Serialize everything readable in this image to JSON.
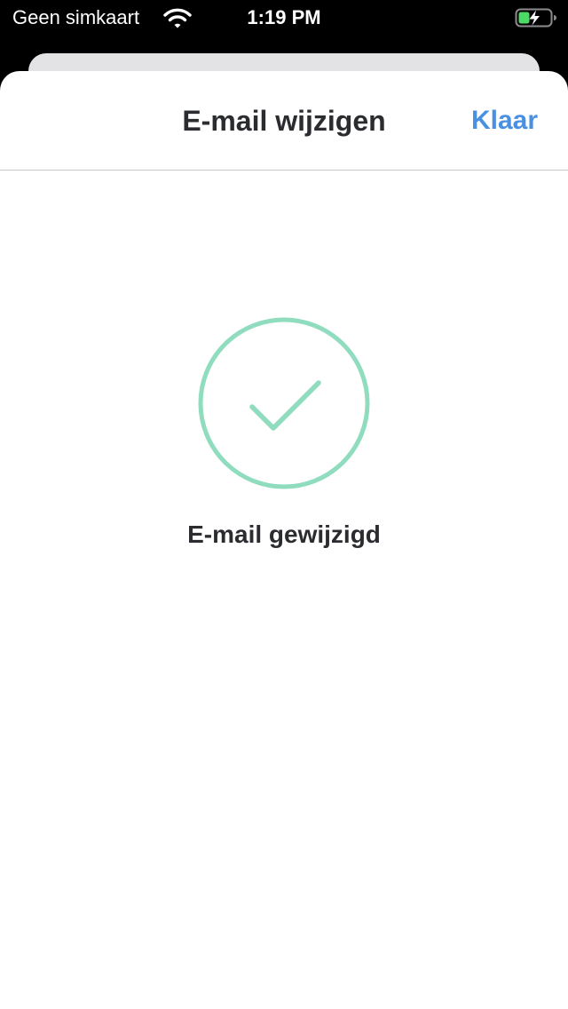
{
  "status_bar": {
    "carrier": "Geen simkaart",
    "time": "1:19 PM",
    "wifi_icon": "wifi-icon",
    "battery_icon": "battery-charging-icon",
    "battery_color": "#4cd964"
  },
  "nav": {
    "title": "E-mail wijzigen",
    "done_label": "Klaar"
  },
  "content": {
    "success_icon": "checkmark-circle-icon",
    "message": "E-mail gewijzigd"
  },
  "colors": {
    "accent": "#4a90e2",
    "success": "#8fdcbf",
    "text": "#2b2c30"
  }
}
